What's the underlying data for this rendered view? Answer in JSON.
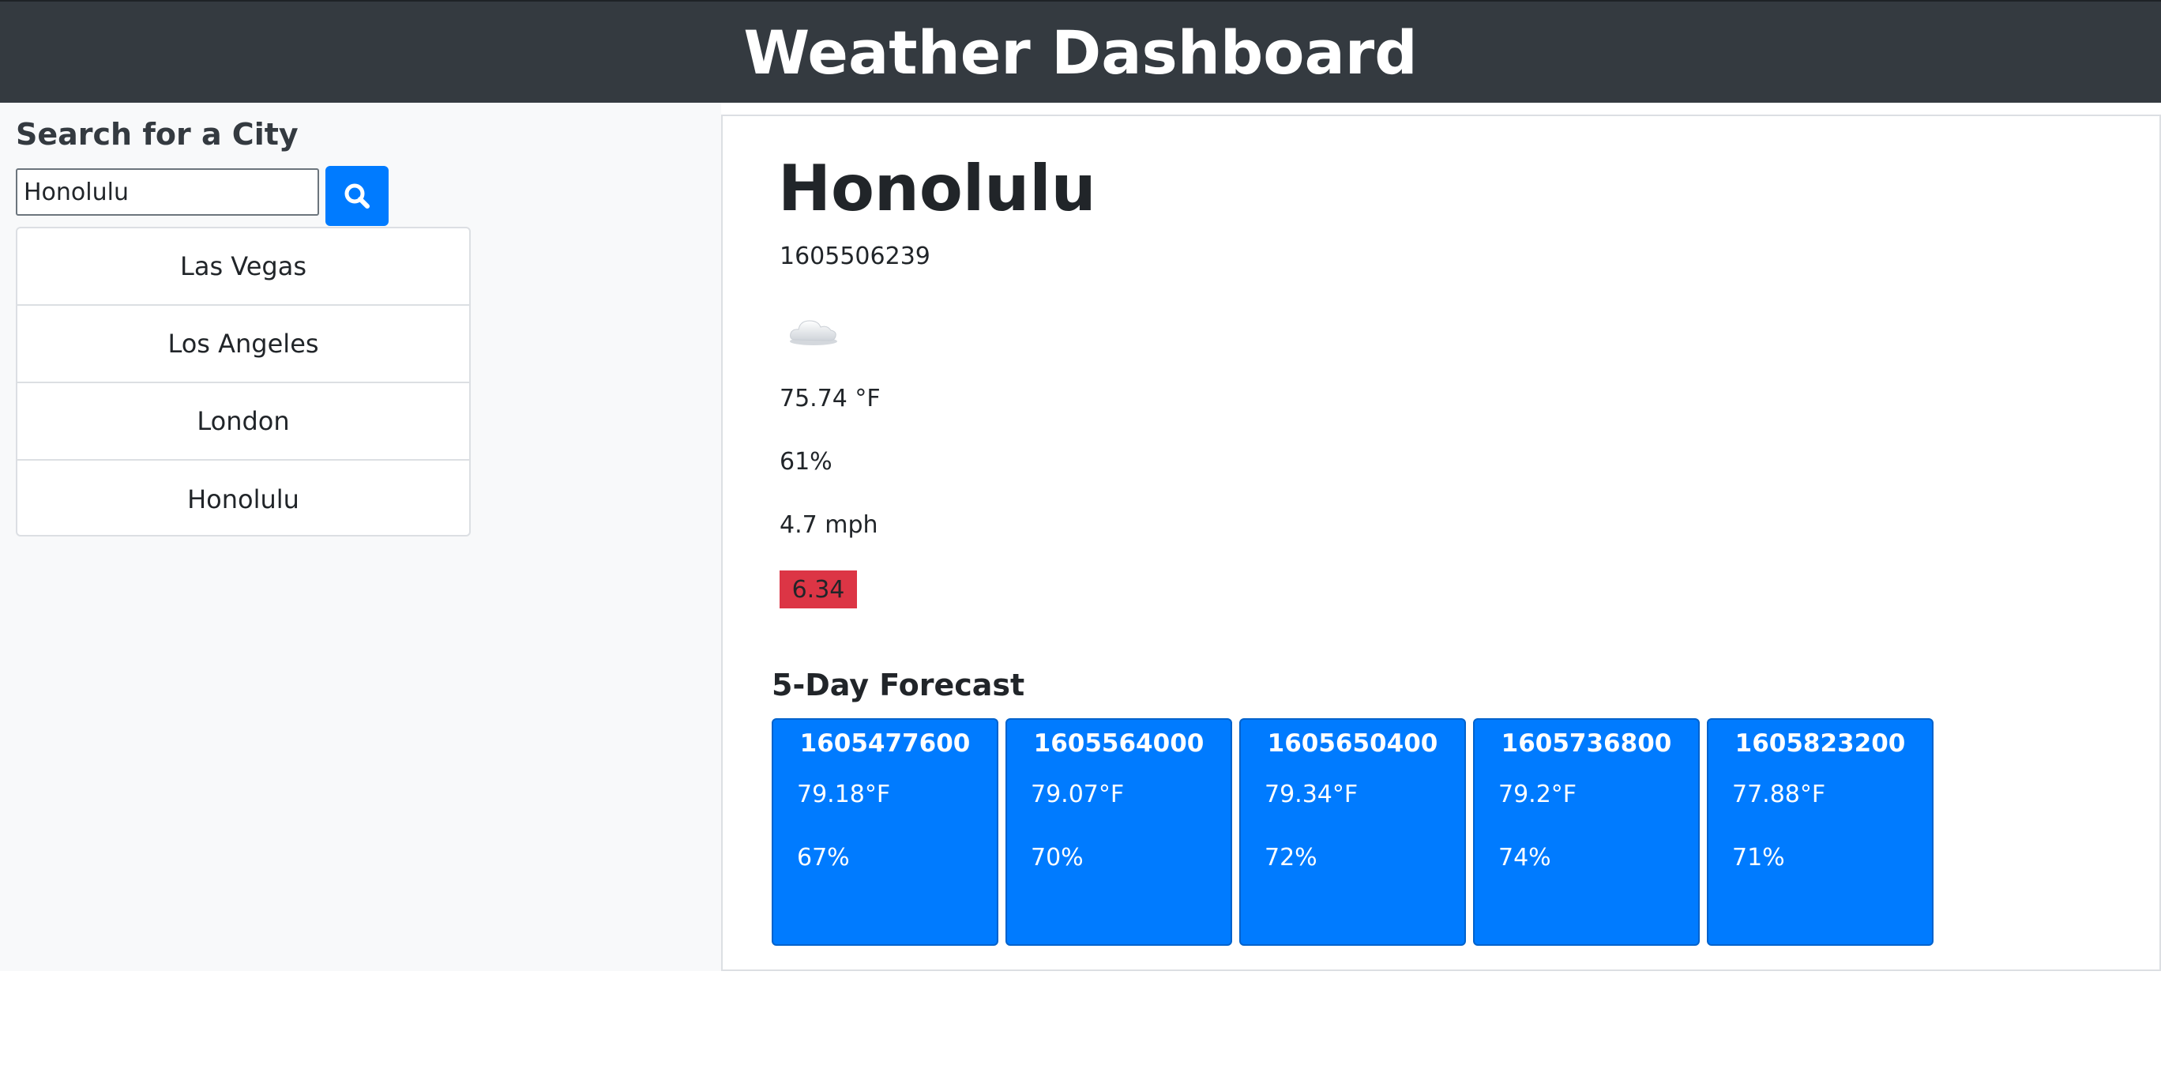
{
  "header": {
    "title": "Weather Dashboard"
  },
  "sidebar": {
    "heading": "Search for a City",
    "search": {
      "value": "Honolulu",
      "placeholder": ""
    },
    "history": [
      {
        "label": "Las Vegas"
      },
      {
        "label": "Los Angeles"
      },
      {
        "label": "London"
      },
      {
        "label": "Honolulu"
      }
    ]
  },
  "current": {
    "city": "Honolulu",
    "date": "1605506239",
    "icon": "cloud-icon",
    "temp": "75.74 °F",
    "humidity": "61%",
    "wind": "4.7 mph",
    "uv": "6.34"
  },
  "forecast": {
    "title": "5-Day Forecast",
    "days": [
      {
        "date": "1605477600",
        "temp": "79.18°F",
        "humidity": "67%"
      },
      {
        "date": "1605564000",
        "temp": "79.07°F",
        "humidity": "70%"
      },
      {
        "date": "1605650400",
        "temp": "79.34°F",
        "humidity": "72%"
      },
      {
        "date": "1605736800",
        "temp": "79.2°F",
        "humidity": "74%"
      },
      {
        "date": "1605823200",
        "temp": "77.88°F",
        "humidity": "71%"
      }
    ]
  },
  "colors": {
    "header_bg": "#343a40",
    "accent": "#007bff",
    "uv_badge": "#dc3545",
    "sidebar_bg": "#f8f9fa"
  }
}
